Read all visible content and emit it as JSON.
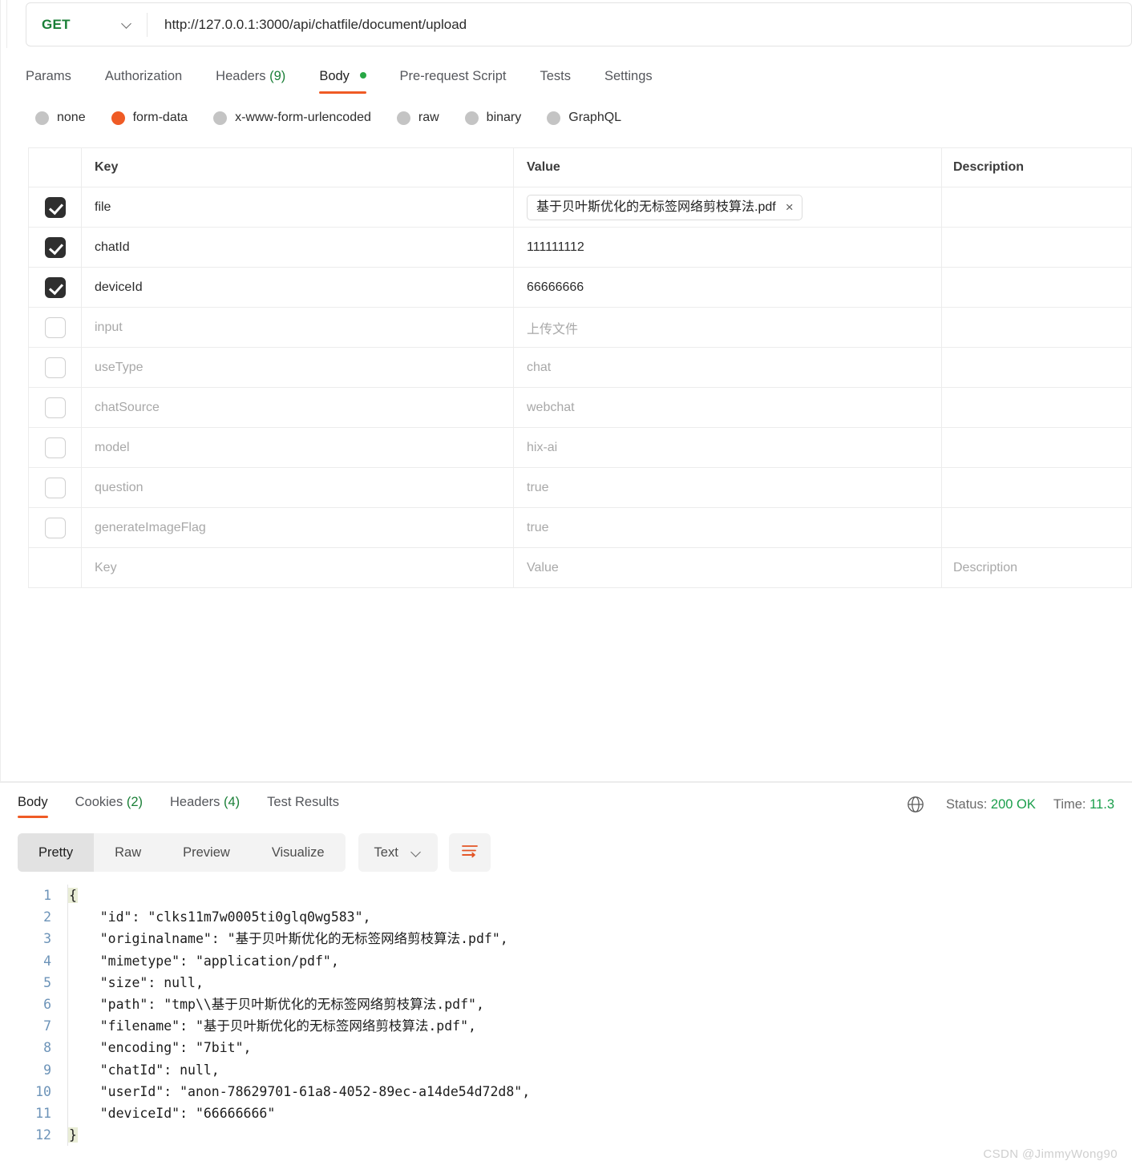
{
  "request": {
    "method": "GET",
    "url": "http://127.0.0.1:3000/api/chatfile/document/upload",
    "method_dropdown_icon": "chevron-down-icon",
    "tabs": [
      {
        "label": "Params",
        "count": "",
        "active": false
      },
      {
        "label": "Authorization",
        "count": "",
        "active": false
      },
      {
        "label": "Headers",
        "count": "(9)",
        "active": false
      },
      {
        "label": "Body",
        "count": "",
        "active": true,
        "dot": "green-dot"
      },
      {
        "label": "Pre-request Script",
        "count": "",
        "active": false
      },
      {
        "label": "Tests",
        "count": "",
        "active": false
      },
      {
        "label": "Settings",
        "count": "",
        "active": false
      }
    ],
    "body_types": [
      {
        "label": "none",
        "selected": false
      },
      {
        "label": "form-data",
        "selected": true
      },
      {
        "label": "x-www-form-urlencoded",
        "selected": false
      },
      {
        "label": "raw",
        "selected": false
      },
      {
        "label": "binary",
        "selected": false
      },
      {
        "label": "GraphQL",
        "selected": false
      }
    ],
    "table": {
      "headers": {
        "key": "Key",
        "value": "Value",
        "description": "Description"
      },
      "rows": [
        {
          "checked": true,
          "key": "file",
          "value": "基于贝叶斯优化的无标签网络剪枝算法.pdf",
          "is_file": true,
          "remove": "×",
          "description": ""
        },
        {
          "checked": true,
          "key": "chatId",
          "value": "111111112",
          "is_file": false,
          "description": ""
        },
        {
          "checked": true,
          "key": "deviceId",
          "value": "66666666",
          "is_file": false,
          "description": ""
        },
        {
          "checked": false,
          "key": "input",
          "value": "上传文件",
          "is_file": false,
          "description": ""
        },
        {
          "checked": false,
          "key": "useType",
          "value": "chat",
          "is_file": false,
          "description": ""
        },
        {
          "checked": false,
          "key": "chatSource",
          "value": "webchat",
          "is_file": false,
          "description": ""
        },
        {
          "checked": false,
          "key": "model",
          "value": "hix-ai",
          "is_file": false,
          "description": ""
        },
        {
          "checked": false,
          "key": "question",
          "value": "true",
          "is_file": false,
          "description": ""
        },
        {
          "checked": false,
          "key": "generateImageFlag",
          "value": "true",
          "is_file": false,
          "description": ""
        }
      ],
      "placeholder_row": {
        "key": "Key",
        "value": "Value",
        "description": "Description"
      }
    }
  },
  "response": {
    "tabs": [
      {
        "label": "Body",
        "count": "",
        "active": true
      },
      {
        "label": "Cookies",
        "count": "(2)",
        "active": false
      },
      {
        "label": "Headers",
        "count": "(4)",
        "active": false
      },
      {
        "label": "Test Results",
        "count": "",
        "active": false
      }
    ],
    "status_icon": "globe-icon",
    "status_label": "Status:",
    "status_value": "200 OK",
    "time_label": "Time:",
    "time_value": "11.3",
    "view_modes": [
      {
        "label": "Pretty",
        "active": true
      },
      {
        "label": "Raw",
        "active": false
      },
      {
        "label": "Preview",
        "active": false
      },
      {
        "label": "Visualize",
        "active": false
      }
    ],
    "format_label": "Text",
    "format_icon": "chevron-down-icon",
    "wrap_icon": "wrap-text-icon",
    "body_lines": [
      {
        "n": "1",
        "code": "{"
      },
      {
        "n": "2",
        "code": "    \"id\": \"clks11m7w0005ti0glq0wg583\","
      },
      {
        "n": "3",
        "code": "    \"originalname\": \"基于贝叶斯优化的无标签网络剪枝算法.pdf\","
      },
      {
        "n": "4",
        "code": "    \"mimetype\": \"application/pdf\","
      },
      {
        "n": "5",
        "code": "    \"size\": null,"
      },
      {
        "n": "6",
        "code": "    \"path\": \"tmp\\\\基于贝叶斯优化的无标签网络剪枝算法.pdf\","
      },
      {
        "n": "7",
        "code": "    \"filename\": \"基于贝叶斯优化的无标签网络剪枝算法.pdf\","
      },
      {
        "n": "8",
        "code": "    \"encoding\": \"7bit\","
      },
      {
        "n": "9",
        "code": "    \"chatId\": null,"
      },
      {
        "n": "10",
        "code": "    \"userId\": \"anon-78629701-61a8-4052-89ec-a14de54d72d8\","
      },
      {
        "n": "11",
        "code": "    \"deviceId\": \"66666666\""
      },
      {
        "n": "12",
        "code": "}"
      }
    ]
  },
  "watermark": "CSDN @JimmyWong90",
  "colors": {
    "accent": "#ef5b25",
    "method_green": "#1a7f37",
    "status_green": "#1a9e4b",
    "line_number": "#6c93b8"
  }
}
